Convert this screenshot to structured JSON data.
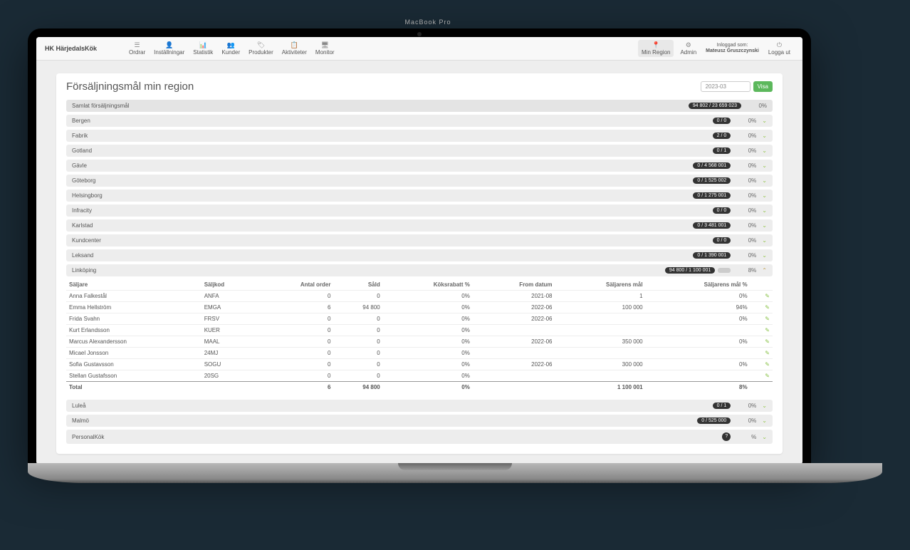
{
  "brand": "HK HärjedalsKök",
  "nav": {
    "items": [
      {
        "label": "Ordrar"
      },
      {
        "label": "Inställningar"
      },
      {
        "label": "Statistik"
      },
      {
        "label": "Kunder"
      },
      {
        "label": "Produkter"
      },
      {
        "label": "Aktiviteter"
      },
      {
        "label": "Monitor"
      }
    ],
    "right": {
      "min_region": "Min Region",
      "admin": "Admin",
      "logged_as_label": "Inloggad som:",
      "user": "Mateusz Gruszczynski",
      "logout": "Logga ut"
    }
  },
  "page": {
    "title": "Försäljningsmål min region",
    "date": "2023-03",
    "visa": "Visa"
  },
  "summary": {
    "label": "Samlat försäljningsmål",
    "badge": "94 802 / 23 659 023",
    "pct": "0%"
  },
  "regions": [
    {
      "name": "Bergen",
      "badge": "0 / 0",
      "pct": "0%"
    },
    {
      "name": "Fabrik",
      "badge": "2 / 0",
      "pct": "0%"
    },
    {
      "name": "Gotland",
      "badge": "0 / 1",
      "pct": "0%"
    },
    {
      "name": "Gävle",
      "badge": "0 / 4 568 001",
      "pct": "0%"
    },
    {
      "name": "Göteborg",
      "badge": "0 / 1 525 002",
      "pct": "0%"
    },
    {
      "name": "Helsingborg",
      "badge": "0 / 1 275 001",
      "pct": "0%"
    },
    {
      "name": "Infracity",
      "badge": "0 / 0",
      "pct": "0%"
    },
    {
      "name": "Karlstad",
      "badge": "0 / 3 481 001",
      "pct": "0%"
    },
    {
      "name": "Kundcenter",
      "badge": "0 / 0",
      "pct": "0%"
    },
    {
      "name": "Leksand",
      "badge": "0 / 1 390 001",
      "pct": "0%"
    }
  ],
  "expanded": {
    "name": "Linköping",
    "badge": "94 800 / 1 100 001",
    "pct": "8%",
    "columns": {
      "saljare": "Säljare",
      "saljkod": "Säljkod",
      "antal": "Antal order",
      "sald": "Såld",
      "rabatt": "Köksrabatt %",
      "from": "From datum",
      "mal": "Säljarens mål",
      "malpct": "Säljarens mål %"
    },
    "rows": [
      {
        "saljare": "Anna Falkestål",
        "kod": "ANFA",
        "antal": "0",
        "sald": "0",
        "rabatt": "0%",
        "from": "2021-08",
        "mal": "1",
        "pct": "0%"
      },
      {
        "saljare": "Emma Hellström",
        "kod": "EMGA",
        "antal": "6",
        "sald": "94 800",
        "rabatt": "0%",
        "from": "2022-06",
        "mal": "100 000",
        "pct": "94%"
      },
      {
        "saljare": "Frida Svahn",
        "kod": "FRSV",
        "antal": "0",
        "sald": "0",
        "rabatt": "0%",
        "from": "2022-06",
        "mal": "",
        "pct": "0%"
      },
      {
        "saljare": "Kurt Erlandsson",
        "kod": "KUER",
        "antal": "0",
        "sald": "0",
        "rabatt": "0%",
        "from": "",
        "mal": "",
        "pct": ""
      },
      {
        "saljare": "Marcus Alexandersson",
        "kod": "MAAL",
        "antal": "0",
        "sald": "0",
        "rabatt": "0%",
        "from": "2022-06",
        "mal": "350 000",
        "pct": "0%"
      },
      {
        "saljare": "Micael Jonsson",
        "kod": "24MJ",
        "antal": "0",
        "sald": "0",
        "rabatt": "0%",
        "from": "",
        "mal": "",
        "pct": ""
      },
      {
        "saljare": "Sofia Gustavsson",
        "kod": "SOGU",
        "antal": "0",
        "sald": "0",
        "rabatt": "0%",
        "from": "2022-06",
        "mal": "300 000",
        "pct": "0%"
      },
      {
        "saljare": "Stellan Gustafsson",
        "kod": "20SG",
        "antal": "0",
        "sald": "0",
        "rabatt": "0%",
        "from": "",
        "mal": "",
        "pct": ""
      }
    ],
    "total": {
      "label": "Total",
      "antal": "6",
      "sald": "94 800",
      "rabatt": "0%",
      "mal": "1 100 001",
      "pct": "8%"
    }
  },
  "regions_after": [
    {
      "name": "Luleå",
      "badge": "0 / 1",
      "pct": "0%"
    },
    {
      "name": "Malmö",
      "badge": "0 / 525 000",
      "pct": "0%"
    },
    {
      "name": "PersonalKök",
      "badge": "?",
      "pct": "%",
      "round": true
    }
  ],
  "laptop_label": "MacBook Pro"
}
